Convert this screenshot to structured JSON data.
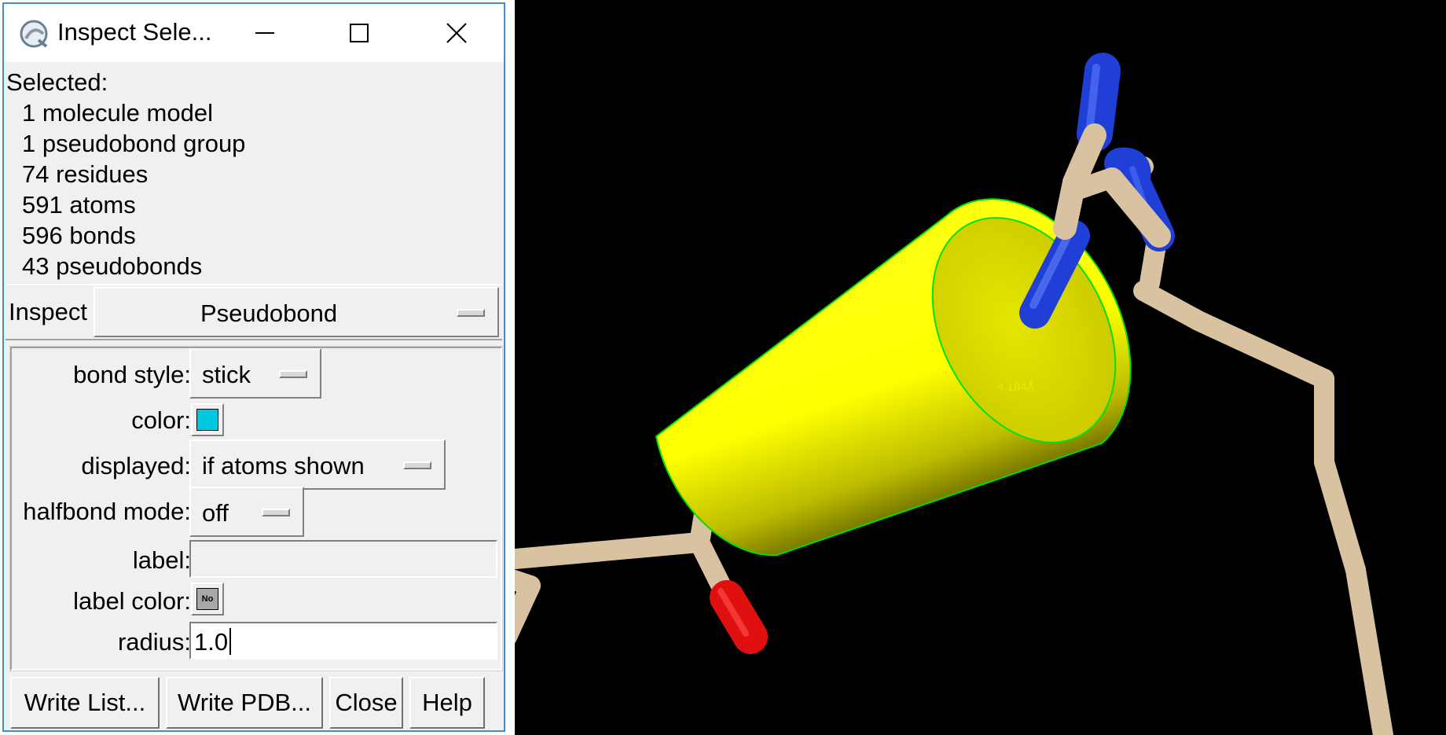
{
  "window": {
    "title": "Inspect Sele...",
    "controls": {
      "minimize": "minimize-icon",
      "maximize": "maximize-icon",
      "close": "close-icon"
    }
  },
  "selection": {
    "heading": "Selected:",
    "items": [
      "1 molecule model",
      "1 pseudobond group",
      "74 residues",
      "591 atoms",
      "596 bonds",
      "43 pseudobonds"
    ]
  },
  "inspect": {
    "label": "Inspect",
    "value": "Pseudobond"
  },
  "attributes": {
    "bond_style": {
      "label": "bond style:",
      "value": "stick"
    },
    "color": {
      "label": "color:",
      "value": "#00c8e0"
    },
    "displayed": {
      "label": "displayed:",
      "value": "if atoms shown"
    },
    "halfbond_mode": {
      "label": "halfbond mode:",
      "value": "off"
    },
    "label": {
      "label": "label:",
      "value": ""
    },
    "label_color": {
      "label": "label color:",
      "swatch_text": "No"
    },
    "radius": {
      "label": "radius:",
      "value": "1.0"
    }
  },
  "buttons": {
    "write_list": "Write List...",
    "write_pdb": "Write PDB...",
    "close": "Close",
    "help": "Help"
  },
  "viewer": {
    "background": "#000000",
    "distance_label": "4.184Å",
    "colors": {
      "carbon": "#d8c2a0",
      "nitrogen": "#1f3fd6",
      "oxygen": "#e01010",
      "pseudobond": "#ffff00",
      "outline": "#00e000"
    }
  }
}
